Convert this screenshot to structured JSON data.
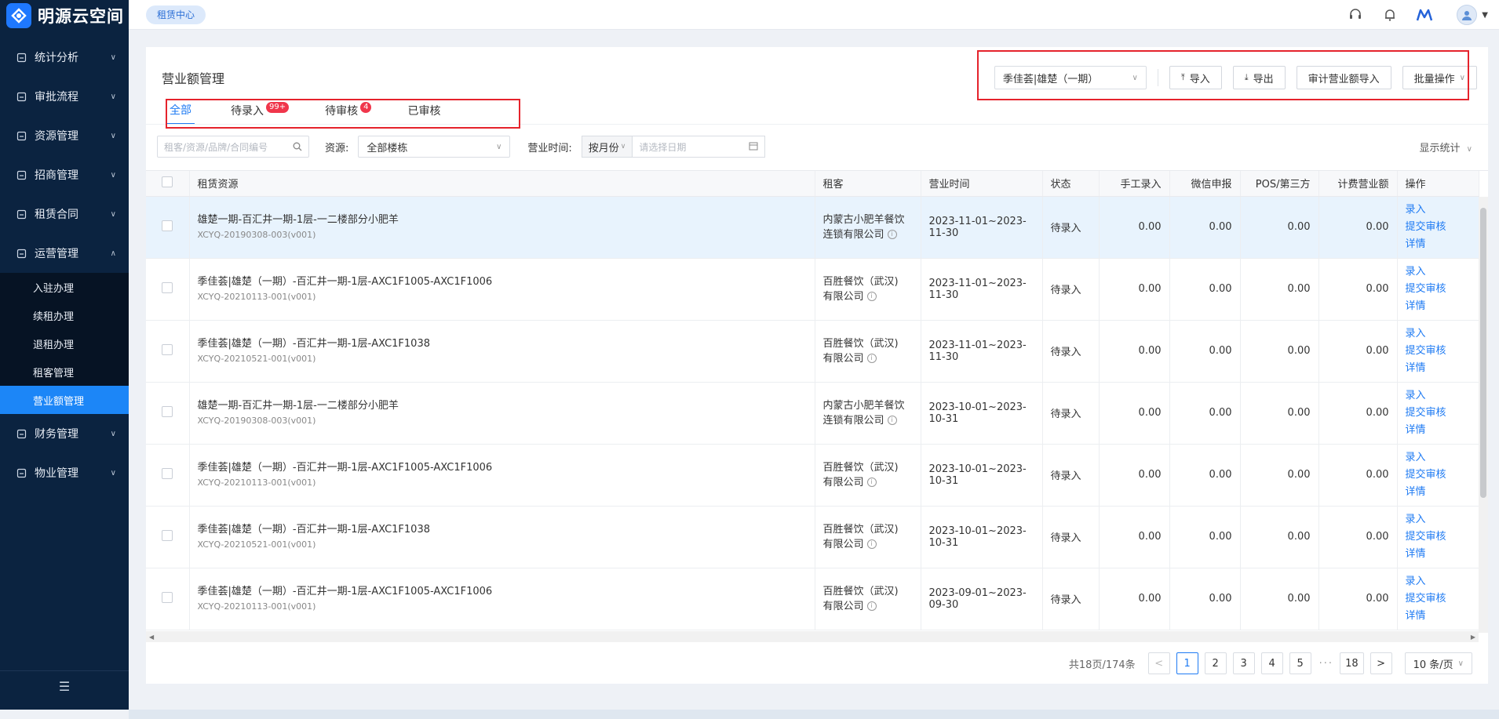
{
  "app": {
    "title": "明源云空间"
  },
  "topbar": {
    "crumb": "租赁中心"
  },
  "sidebar": {
    "menu": [
      {
        "label": "统计分析",
        "icon": "chart-icon"
      },
      {
        "label": "审批流程",
        "icon": "checklist-icon"
      },
      {
        "label": "资源管理",
        "icon": "layers-icon"
      },
      {
        "label": "招商管理",
        "icon": "flag-icon"
      },
      {
        "label": "租赁合同",
        "icon": "contract-icon"
      },
      {
        "label": "运营管理",
        "icon": "monitor-icon"
      }
    ],
    "submenu": [
      "入驻办理",
      "续租办理",
      "退租办理",
      "租客管理",
      "营业额管理"
    ],
    "menu_after": [
      {
        "label": "财务管理",
        "icon": "finance-icon"
      },
      {
        "label": "物业管理",
        "icon": "building-icon"
      }
    ]
  },
  "page": {
    "title": "营业额管理",
    "tabs": [
      {
        "label": "全部",
        "badge": ""
      },
      {
        "label": "待录入",
        "badge": "99+"
      },
      {
        "label": "待审核",
        "badge": "4"
      },
      {
        "label": "已审核",
        "badge": ""
      }
    ],
    "building_select": "季佳荟|雄楚（一期）",
    "buttons": {
      "import": "导入",
      "export": "导出",
      "audit_import": "审计营业额导入",
      "batch": "批量操作"
    },
    "filters": {
      "search_placeholder": "租客/资源/品牌/合同编号",
      "resource_label": "资源:",
      "resource_value": "全部楼栋",
      "time_label": "营业时间:",
      "month_mode": "按月份",
      "date_placeholder": "请选择日期",
      "show_stats": "显示统计"
    }
  },
  "table": {
    "columns": [
      "租赁资源",
      "租客",
      "营业时间",
      "状态",
      "手工录入",
      "微信申报",
      "POS/第三方",
      "计费营业额",
      "操作"
    ],
    "rows": [
      {
        "resource": "雄楚一期-百汇井一期-1层-一二楼部分小肥羊",
        "code": "XCYQ-20190308-003(v001)",
        "tenant1": "内蒙古小肥羊餐饮",
        "tenant2": "连锁有限公司",
        "period": "2023-11-01~2023-11-30",
        "status": "待录入",
        "manual": "0.00",
        "wechat": "0.00",
        "pos": "0.00",
        "billing": "0.00"
      },
      {
        "resource": "季佳荟|雄楚（一期）-百汇井一期-1层-AXC1F1005-AXC1F1006",
        "code": "XCYQ-20210113-001(v001)",
        "tenant1": "百胜餐饮（武汉)",
        "tenant2": "有限公司",
        "period": "2023-11-01~2023-11-30",
        "status": "待录入",
        "manual": "0.00",
        "wechat": "0.00",
        "pos": "0.00",
        "billing": "0.00"
      },
      {
        "resource": "季佳荟|雄楚（一期）-百汇井一期-1层-AXC1F1038",
        "code": "XCYQ-20210521-001(v001)",
        "tenant1": "百胜餐饮（武汉)",
        "tenant2": "有限公司",
        "period": "2023-11-01~2023-11-30",
        "status": "待录入",
        "manual": "0.00",
        "wechat": "0.00",
        "pos": "0.00",
        "billing": "0.00"
      },
      {
        "resource": "雄楚一期-百汇井一期-1层-一二楼部分小肥羊",
        "code": "XCYQ-20190308-003(v001)",
        "tenant1": "内蒙古小肥羊餐饮",
        "tenant2": "连锁有限公司",
        "period": "2023-10-01~2023-10-31",
        "status": "待录入",
        "manual": "0.00",
        "wechat": "0.00",
        "pos": "0.00",
        "billing": "0.00"
      },
      {
        "resource": "季佳荟|雄楚（一期）-百汇井一期-1层-AXC1F1005-AXC1F1006",
        "code": "XCYQ-20210113-001(v001)",
        "tenant1": "百胜餐饮（武汉)",
        "tenant2": "有限公司",
        "period": "2023-10-01~2023-10-31",
        "status": "待录入",
        "manual": "0.00",
        "wechat": "0.00",
        "pos": "0.00",
        "billing": "0.00"
      },
      {
        "resource": "季佳荟|雄楚（一期）-百汇井一期-1层-AXC1F1038",
        "code": "XCYQ-20210521-001(v001)",
        "tenant1": "百胜餐饮（武汉)",
        "tenant2": "有限公司",
        "period": "2023-10-01~2023-10-31",
        "status": "待录入",
        "manual": "0.00",
        "wechat": "0.00",
        "pos": "0.00",
        "billing": "0.00"
      },
      {
        "resource": "季佳荟|雄楚（一期）-百汇井一期-1层-AXC1F1005-AXC1F1006",
        "code": "XCYQ-20210113-001(v001)",
        "tenant1": "百胜餐饮（武汉)",
        "tenant2": "有限公司",
        "period": "2023-09-01~2023-09-30",
        "status": "待录入",
        "manual": "0.00",
        "wechat": "0.00",
        "pos": "0.00",
        "billing": "0.00"
      }
    ],
    "ops": [
      "录入",
      "提交审核",
      "详情"
    ]
  },
  "pagination": {
    "total": "共18页/174条",
    "prev": "<",
    "next": ">",
    "pages": [
      "1",
      "2",
      "3",
      "4",
      "5"
    ],
    "ellipsis": "···",
    "last": "18",
    "page_size": "10 条/页"
  }
}
